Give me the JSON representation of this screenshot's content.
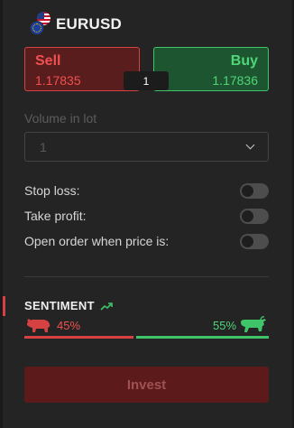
{
  "instrument": {
    "symbol": "EURUSD",
    "flags": [
      "us-flag-icon",
      "eu-flag-icon"
    ]
  },
  "sell": {
    "label": "Sell",
    "price": "1.17835"
  },
  "buy": {
    "label": "Buy",
    "price": "1.17836"
  },
  "spread": "1",
  "volume": {
    "label": "Volume in lot",
    "value": "1"
  },
  "options": [
    {
      "label": "Stop loss:",
      "enabled": false
    },
    {
      "label": "Take profit:",
      "enabled": false
    },
    {
      "label": "Open order when price is:",
      "enabled": false
    }
  ],
  "sentiment": {
    "title": "SENTIMENT",
    "sell_pct": "45%",
    "buy_pct": "55%",
    "sell_share": 0.45,
    "buy_share": 0.55
  },
  "invest_label": "Invest",
  "colors": {
    "sell": "#d64242",
    "buy": "#3fc46a",
    "background": "#242424"
  }
}
